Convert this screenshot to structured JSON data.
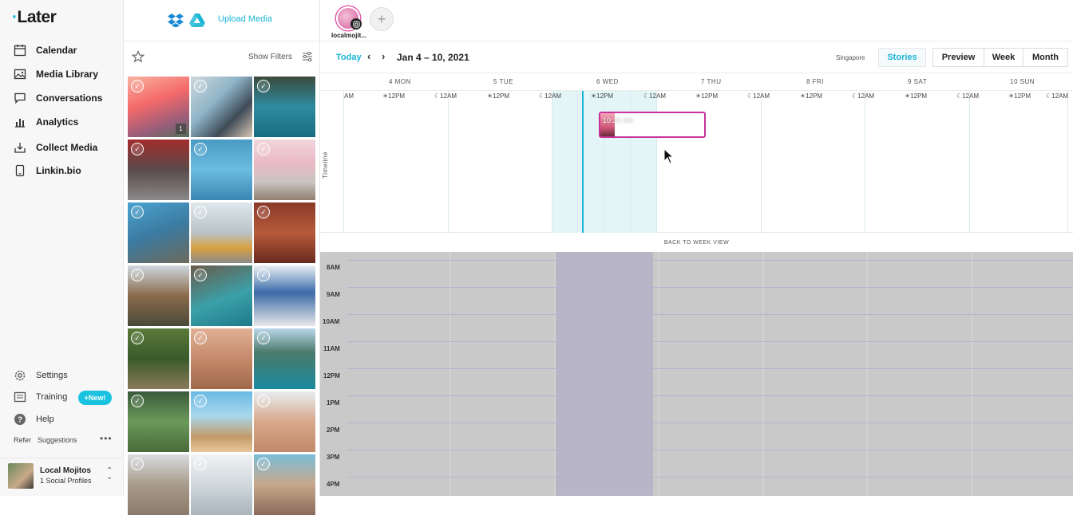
{
  "nav": {
    "logo": "Later",
    "items": [
      {
        "label": "Calendar",
        "icon": "calendar-icon"
      },
      {
        "label": "Media Library",
        "icon": "media-library-icon"
      },
      {
        "label": "Conversations",
        "icon": "conversations-icon"
      },
      {
        "label": "Analytics",
        "icon": "analytics-icon"
      },
      {
        "label": "Collect Media",
        "icon": "collect-media-icon"
      },
      {
        "label": "Linkin.bio",
        "icon": "linkinbio-icon"
      }
    ],
    "bottom": [
      {
        "label": "Settings",
        "icon": "gear-icon"
      },
      {
        "label": "Training",
        "icon": "training-icon"
      },
      {
        "label": "Help",
        "icon": "help-icon"
      }
    ],
    "new_badge": "+New!",
    "refer": "Refer",
    "suggestions": "Suggestions",
    "more": "•••",
    "profile": {
      "name": "Local Mojitos",
      "count": "1 Social Profiles"
    }
  },
  "media": {
    "upload_label": "Upload Media",
    "show_filters": "Show Filters",
    "first_thumb_count": "1"
  },
  "topbar": {
    "profile_name": "localmojit..."
  },
  "calendar": {
    "today": "Today",
    "date_range": "Jan 4 – 10, 2021",
    "timezone": "Singapore",
    "stories": "Stories",
    "views": [
      "Preview",
      "Week",
      "Month"
    ],
    "days": [
      "4 MON",
      "5 TUE",
      "6 WED",
      "7 THU",
      "8 FRI",
      "9 SAT",
      "10 SUN"
    ],
    "timeline_label": "Timeline",
    "ticks": [
      "AM",
      "☀12PM",
      "☾12AM",
      "☀12PM",
      "☾12AM",
      "☀12PM",
      "☾12AM",
      "☀12PM",
      "☾12AM",
      "☀12PM",
      "☾12AM",
      "☀12PM",
      "☾12AM",
      "☀12PM",
      "☾12AM"
    ],
    "event_time": "10:39 AM",
    "back_to_week": "BACK TO WEEK VIEW",
    "hours": [
      "8AM",
      "9AM",
      "10AM",
      "11AM",
      "12PM",
      "1PM",
      "2PM",
      "3PM",
      "4PM"
    ]
  },
  "colors": {
    "accent": "#19b5d4",
    "event_border": "#c8339a",
    "overlay": "#c9c9c9"
  }
}
